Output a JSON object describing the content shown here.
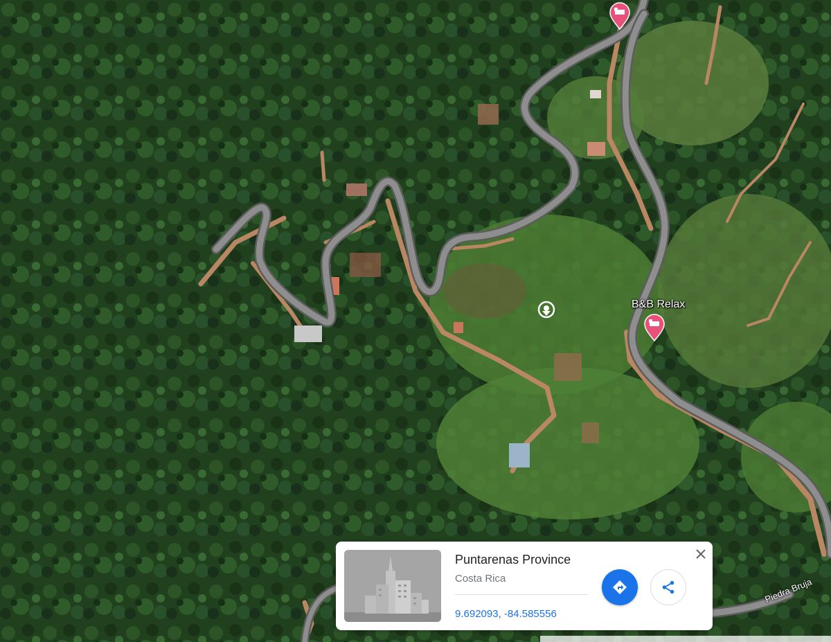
{
  "map": {
    "type": "satellite",
    "poi": {
      "name": "B&B Relax",
      "icon": "hotel-marker-icon"
    },
    "roads": [
      {
        "name": "Piedra Bruja"
      }
    ],
    "colors": {
      "forest": "#1f3a1c",
      "road": "#8e8e8e",
      "dirt": "#b98763",
      "hotel_marker": "#e8527a"
    }
  },
  "info_card": {
    "title": "Puntarenas Province",
    "subtitle": "Costa Rica",
    "coordinates": "9.692093, -84.585556",
    "directions_icon": "directions-icon",
    "share_icon": "share-icon",
    "close_icon": "close-icon",
    "accent_color": "#1a73e8"
  }
}
